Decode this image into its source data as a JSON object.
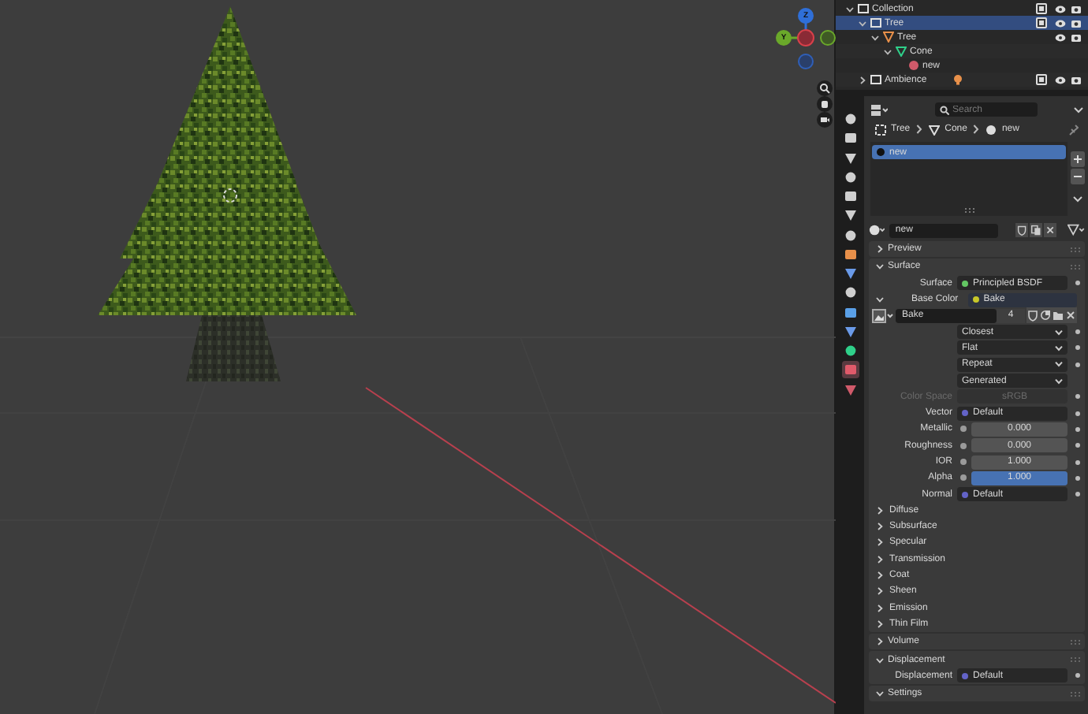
{
  "viewport": {
    "gizmo_axes": [
      {
        "label": "Z",
        "kind": "z"
      },
      {
        "label": "Y",
        "kind": "y"
      }
    ]
  },
  "outliner": {
    "items": [
      {
        "label": "Collection",
        "kind": "collection",
        "expanded": true,
        "selected": false,
        "checked": true,
        "toggles": true,
        "children": [
          {
            "label": "Tree",
            "kind": "collection",
            "expanded": true,
            "selected": true,
            "checked": true,
            "toggles": true,
            "children": [
              {
                "label": "Tree",
                "kind": "object",
                "expanded": true,
                "selected": false,
                "toggles": true,
                "children": [
                  {
                    "label": "Cone",
                    "kind": "mesh",
                    "expanded": true,
                    "selected": false,
                    "children": [
                      {
                        "label": "new",
                        "kind": "material",
                        "selected": false
                      }
                    ]
                  }
                ]
              }
            ]
          },
          {
            "label": "Ambience",
            "kind": "collection",
            "expanded": false,
            "selected": false,
            "checked": true,
            "toggles": true,
            "collapsed_children": [
              {
                "kind": "light"
              }
            ]
          }
        ]
      }
    ]
  },
  "properties": {
    "tabs": [
      {
        "selected": false
      },
      {
        "selected": false
      },
      {
        "selected": false
      },
      {
        "selected": false
      },
      {
        "selected": false
      },
      {
        "selected": false
      },
      {
        "selected": false
      },
      {
        "selected": false
      },
      {
        "selected": false
      },
      {
        "selected": false
      },
      {
        "selected": false
      },
      {
        "selected": false
      },
      {
        "selected": false
      },
      {
        "selected": true
      },
      {
        "selected": false
      }
    ],
    "search": {
      "placeholder": "Search"
    },
    "breadcrumb": [
      {
        "label": "Tree",
        "kind": "object"
      },
      {
        "label": "Cone",
        "kind": "mesh"
      },
      {
        "label": "new",
        "kind": "material"
      }
    ],
    "slots": [
      {
        "label": "new",
        "selected": true
      }
    ],
    "material": {
      "value": "new"
    },
    "panels": [
      {
        "label": "Preview",
        "expanded": false
      },
      {
        "label": "Surface",
        "expanded": true,
        "rows": [
          {
            "kind": "socket",
            "label": "Surface",
            "value": "Principled BSDF",
            "color": "#63c763"
          },
          {
            "kind": "link",
            "label": "Base Color",
            "value": "Bake",
            "color": "#c7c729",
            "expanded": true
          },
          {
            "kind": "image",
            "value": "Bake",
            "users": "4"
          },
          {
            "kind": "dropdown",
            "value": "Closest",
            "keyframe": true
          },
          {
            "kind": "dropdown",
            "value": "Flat",
            "keyframe": true
          },
          {
            "kind": "dropdown",
            "value": "Repeat",
            "keyframe": true
          },
          {
            "kind": "dropdown",
            "value": "Generated",
            "keyframe": false
          },
          {
            "kind": "field",
            "label": "Color Space",
            "value": "sRGB",
            "disabled": true
          },
          {
            "kind": "socket",
            "label": "Vector",
            "value": "Default",
            "color": "#6363c7"
          },
          {
            "kind": "number",
            "label": "Metallic",
            "value": "0.000"
          },
          {
            "kind": "number",
            "label": "Roughness",
            "value": "0.000"
          },
          {
            "kind": "number",
            "label": "IOR",
            "value": "1.000"
          },
          {
            "kind": "slider",
            "label": "Alpha",
            "value": "1.000",
            "level": 1
          },
          {
            "kind": "socket",
            "label": "Normal",
            "value": "Default",
            "color": "#6363c7"
          },
          {
            "kind": "subpanel",
            "label": "Diffuse",
            "expanded": false
          },
          {
            "kind": "subpanel",
            "label": "Subsurface",
            "expanded": false
          },
          {
            "kind": "subpanel",
            "label": "Specular",
            "expanded": false
          },
          {
            "kind": "subpanel",
            "label": "Transmission",
            "expanded": false
          },
          {
            "kind": "subpanel",
            "label": "Coat",
            "expanded": false
          },
          {
            "kind": "subpanel",
            "label": "Sheen",
            "expanded": false
          },
          {
            "kind": "subpanel",
            "label": "Emission",
            "expanded": false
          },
          {
            "kind": "subpanel",
            "label": "Thin Film",
            "expanded": false
          }
        ]
      },
      {
        "label": "Volume",
        "expanded": false
      },
      {
        "label": "Displacement",
        "expanded": true,
        "rows": [
          {
            "kind": "socket",
            "label": "Displacement",
            "value": "Default",
            "color": "#6363c7"
          }
        ]
      },
      {
        "label": "Settings",
        "expanded": true
      }
    ]
  }
}
